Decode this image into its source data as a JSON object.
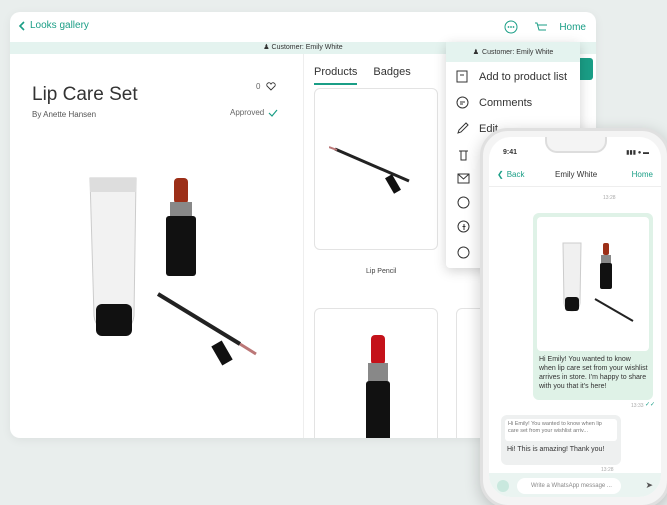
{
  "nav": {
    "back_label": "Looks gallery",
    "home_label": "Home"
  },
  "customer_bar": "Customer: Emily White",
  "look": {
    "title": "Lip Care Set",
    "author": "By Anette Hansen",
    "likes": "0",
    "status": "Approved"
  },
  "tabs": [
    {
      "label": "Products",
      "active": true
    },
    {
      "label": "Badges",
      "active": false
    }
  ],
  "products": [
    {
      "label": "Lip Pencil"
    }
  ],
  "menu": {
    "header": "Customer: Emily White",
    "items": [
      {
        "label": "Add to product list",
        "icon": "product-list-icon"
      },
      {
        "label": "Comments",
        "icon": "comment-icon"
      },
      {
        "label": "Edit",
        "icon": "pencil-icon"
      }
    ]
  },
  "phone": {
    "time": "9:41",
    "back_label": "Back",
    "contact": "Emily White",
    "home_label": "Home",
    "timestamps": [
      "13:28",
      "13:33",
      "13:28"
    ],
    "outgoing_message": "Hi Emily! You wanted to know when lip care set from your wishlist arrives in store. I'm happy to share with you that it's here!",
    "quoted_message": "Hi Emily! You wanted to know when lip care set from your wishlist arriv...",
    "incoming_message": "Hi! This is amazing! Thank you!",
    "input_placeholder": "Write a WhatsApp message ..."
  },
  "colors": {
    "accent": "#1a9e86",
    "customer_bar": "#e4f3ef",
    "bubble_out": "#dff2e7"
  }
}
